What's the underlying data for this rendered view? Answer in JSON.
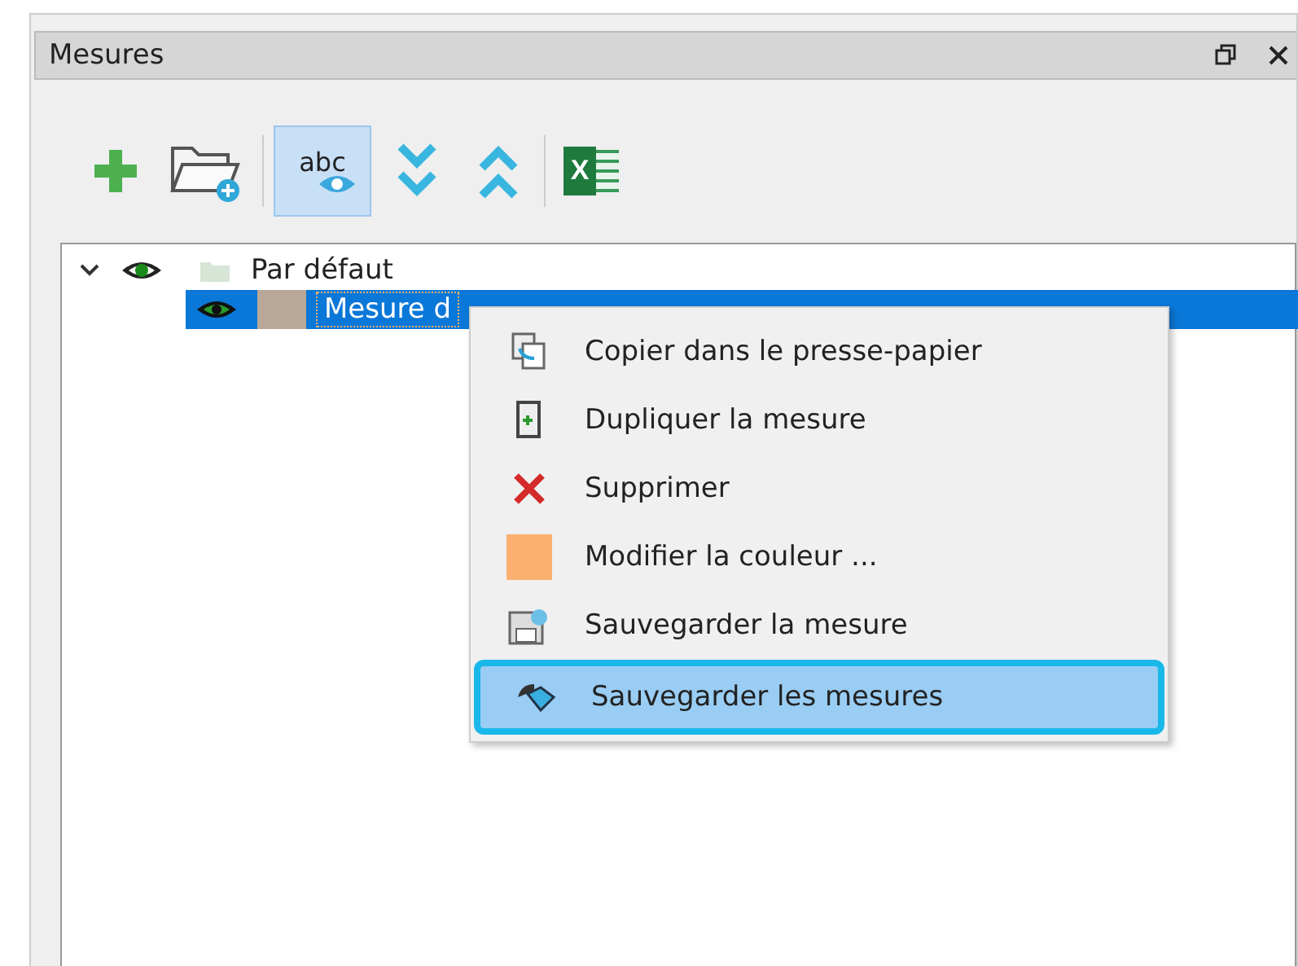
{
  "panel": {
    "title": "Mesures"
  },
  "toolbar": [
    {
      "kind": "add",
      "selected": false
    },
    {
      "kind": "open",
      "selected": false
    },
    {
      "kind": "sep"
    },
    {
      "kind": "labels",
      "text": "abc",
      "selected": true
    },
    {
      "kind": "expand",
      "selected": false
    },
    {
      "kind": "collapse",
      "selected": false
    },
    {
      "kind": "sep"
    },
    {
      "kind": "excel",
      "text": "X",
      "selected": false
    }
  ],
  "tree": [
    {
      "label": "Par défaut",
      "expanded": true,
      "children": [
        {
          "label": "Mesure d",
          "selected": true,
          "color": "#b8a898"
        }
      ]
    }
  ],
  "context_menu": [
    {
      "kind": "copy",
      "label": "Copier dans le presse-papier",
      "selected": false
    },
    {
      "kind": "duplicate",
      "label": "Dupliquer la mesure",
      "selected": false
    },
    {
      "kind": "delete",
      "label": "Supprimer",
      "selected": false
    },
    {
      "kind": "color",
      "label": "Modifier la couleur ...",
      "selected": false
    },
    {
      "kind": "save",
      "label": "Sauvegarder la mesure",
      "selected": false
    },
    {
      "kind": "saveall",
      "label": "Sauvegarder les mesures",
      "selected": true
    }
  ]
}
